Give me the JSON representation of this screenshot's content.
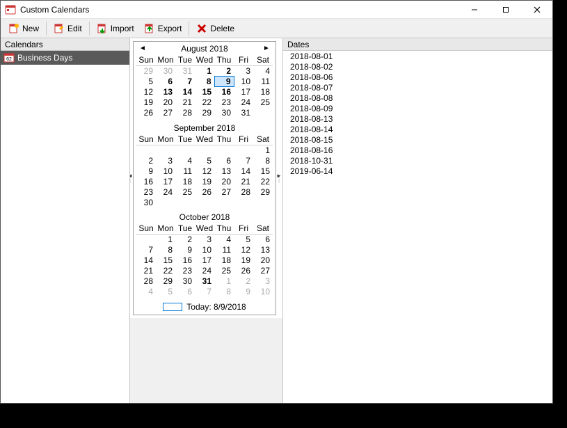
{
  "window": {
    "title": "Custom Calendars"
  },
  "toolbar": {
    "new": "New",
    "edit": "Edit",
    "import": "Import",
    "export": "Export",
    "delete": "Delete"
  },
  "panels": {
    "calendars": "Calendars",
    "dates": "Dates"
  },
  "calendar_list": {
    "items": [
      {
        "label": "Business Days",
        "selected": true
      }
    ]
  },
  "months": [
    {
      "title": "August 2018",
      "has_nav": true,
      "dow": [
        "Sun",
        "Mon",
        "Tue",
        "Wed",
        "Thu",
        "Fri",
        "Sat"
      ],
      "rows": [
        [
          {
            "n": 29,
            "other": true
          },
          {
            "n": 30,
            "other": true
          },
          {
            "n": 31,
            "other": true
          },
          {
            "n": 1,
            "bold": true
          },
          {
            "n": 2,
            "bold": true
          },
          {
            "n": 3
          },
          {
            "n": 4
          }
        ],
        [
          {
            "n": 5
          },
          {
            "n": 6,
            "bold": true
          },
          {
            "n": 7,
            "bold": true
          },
          {
            "n": 8,
            "bold": true
          },
          {
            "n": 9,
            "bold": true,
            "today": true
          },
          {
            "n": 10
          },
          {
            "n": 11
          }
        ],
        [
          {
            "n": 12
          },
          {
            "n": 13,
            "bold": true
          },
          {
            "n": 14,
            "bold": true
          },
          {
            "n": 15,
            "bold": true
          },
          {
            "n": 16,
            "bold": true
          },
          {
            "n": 17
          },
          {
            "n": 18
          }
        ],
        [
          {
            "n": 19
          },
          {
            "n": 20
          },
          {
            "n": 21
          },
          {
            "n": 22
          },
          {
            "n": 23
          },
          {
            "n": 24
          },
          {
            "n": 25
          }
        ],
        [
          {
            "n": 26
          },
          {
            "n": 27
          },
          {
            "n": 28
          },
          {
            "n": 29
          },
          {
            "n": 30
          },
          {
            "n": 31
          },
          {
            "n": ""
          }
        ]
      ]
    },
    {
      "title": "September 2018",
      "has_nav": false,
      "side_nibs": true,
      "dow": [
        "Sun",
        "Mon",
        "Tue",
        "Wed",
        "Thu",
        "Fri",
        "Sat"
      ],
      "rows": [
        [
          {
            "n": ""
          },
          {
            "n": ""
          },
          {
            "n": ""
          },
          {
            "n": ""
          },
          {
            "n": ""
          },
          {
            "n": ""
          },
          {
            "n": 1
          }
        ],
        [
          {
            "n": 2
          },
          {
            "n": 3
          },
          {
            "n": 4
          },
          {
            "n": 5
          },
          {
            "n": 6
          },
          {
            "n": 7
          },
          {
            "n": 8
          }
        ],
        [
          {
            "n": 9
          },
          {
            "n": 10
          },
          {
            "n": 11
          },
          {
            "n": 12
          },
          {
            "n": 13
          },
          {
            "n": 14
          },
          {
            "n": 15
          }
        ],
        [
          {
            "n": 16
          },
          {
            "n": 17
          },
          {
            "n": 18
          },
          {
            "n": 19
          },
          {
            "n": 20
          },
          {
            "n": 21
          },
          {
            "n": 22
          }
        ],
        [
          {
            "n": 23
          },
          {
            "n": 24
          },
          {
            "n": 25
          },
          {
            "n": 26
          },
          {
            "n": 27
          },
          {
            "n": 28
          },
          {
            "n": 29
          }
        ],
        [
          {
            "n": 30
          },
          {
            "n": ""
          },
          {
            "n": ""
          },
          {
            "n": ""
          },
          {
            "n": ""
          },
          {
            "n": ""
          },
          {
            "n": ""
          }
        ]
      ]
    },
    {
      "title": "October 2018",
      "has_nav": false,
      "dow": [
        "Sun",
        "Mon",
        "Tue",
        "Wed",
        "Thu",
        "Fri",
        "Sat"
      ],
      "rows": [
        [
          {
            "n": ""
          },
          {
            "n": 1
          },
          {
            "n": 2
          },
          {
            "n": 3
          },
          {
            "n": 4
          },
          {
            "n": 5
          },
          {
            "n": 6
          }
        ],
        [
          {
            "n": 7
          },
          {
            "n": 8
          },
          {
            "n": 9
          },
          {
            "n": 10
          },
          {
            "n": 11
          },
          {
            "n": 12
          },
          {
            "n": 13
          }
        ],
        [
          {
            "n": 14
          },
          {
            "n": 15
          },
          {
            "n": 16
          },
          {
            "n": 17
          },
          {
            "n": 18
          },
          {
            "n": 19
          },
          {
            "n": 20
          }
        ],
        [
          {
            "n": 21
          },
          {
            "n": 22
          },
          {
            "n": 23
          },
          {
            "n": 24
          },
          {
            "n": 25
          },
          {
            "n": 26
          },
          {
            "n": 27
          }
        ],
        [
          {
            "n": 28
          },
          {
            "n": 29
          },
          {
            "n": 30
          },
          {
            "n": 31,
            "bold": true
          },
          {
            "n": 1,
            "other": true
          },
          {
            "n": 2,
            "other": true
          },
          {
            "n": 3,
            "other": true
          }
        ],
        [
          {
            "n": 4,
            "other": true
          },
          {
            "n": 5,
            "other": true
          },
          {
            "n": 6,
            "other": true
          },
          {
            "n": 7,
            "other": true
          },
          {
            "n": 8,
            "other": true
          },
          {
            "n": 9,
            "other": true
          },
          {
            "n": 10,
            "other": true
          }
        ]
      ]
    }
  ],
  "today_label": "Today: 8/9/2018",
  "dates": [
    "2018-08-01",
    "2018-08-02",
    "2018-08-06",
    "2018-08-07",
    "2018-08-08",
    "2018-08-09",
    "2018-08-13",
    "2018-08-14",
    "2018-08-15",
    "2018-08-16",
    "2018-10-31",
    "2019-06-14"
  ]
}
